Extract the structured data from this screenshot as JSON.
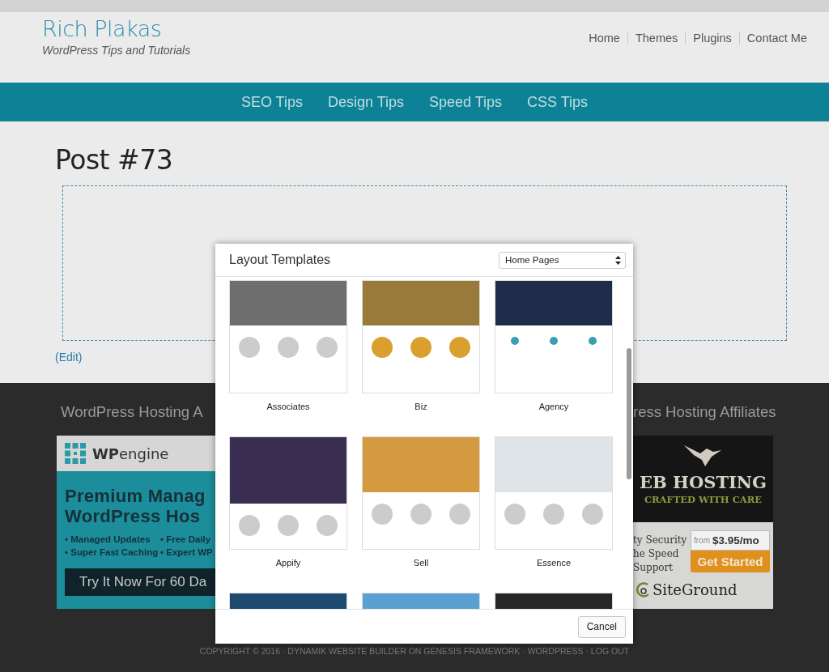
{
  "site": {
    "title": "Rich Plakas",
    "tagline": "WordPress Tips and Tutorials"
  },
  "top_nav": [
    "Home",
    "Themes",
    "Plugins",
    "Contact Me"
  ],
  "category_nav": [
    "SEO Tips",
    "Design Tips",
    "Speed Tips",
    "CSS Tips"
  ],
  "post": {
    "title": "Post #73",
    "edit_link": "(Edit)"
  },
  "footer": {
    "left_heading": "WordPress Hosting A",
    "right_heading": "ress Hosting Affiliates",
    "left_ad": {
      "brand_bold": "WP",
      "brand_light": "engine",
      "headline": [
        "Premium Manag",
        "WordPress Hos"
      ],
      "features": [
        "• Managed Updates",
        "• Free Daily",
        "• Super Fast Caching",
        "• Expert WP"
      ],
      "cta": "Try It Now For 60 Da"
    },
    "right_ad": {
      "headline": "EB HOSTING",
      "subline": "CRAFTED WITH CARE",
      "features": [
        "ty Security",
        "he Speed",
        "Support"
      ],
      "price_from": "from",
      "price": "$3.95/mo",
      "cta": "Get Started",
      "brand": "SiteGround"
    },
    "copyright": "COPYRIGHT © 2016 · DYNAMIK WEBSITE BUILDER ON GENESIS FRAMEWORK · WORDPRESS · LOG OUT"
  },
  "modal": {
    "title": "Layout Templates",
    "category": "Home Pages",
    "templates": [
      {
        "kind": "full",
        "name": "Associates"
      },
      {
        "kind": "full",
        "name": "Biz"
      },
      {
        "kind": "full",
        "name": "Agency"
      },
      {
        "kind": "full",
        "name": "Appify"
      },
      {
        "kind": "full",
        "name": "Sell"
      },
      {
        "kind": "full",
        "name": "Essence"
      },
      {
        "kind": "cut"
      },
      {
        "kind": "cut"
      },
      {
        "kind": "cut"
      }
    ],
    "cancel": "Cancel"
  }
}
